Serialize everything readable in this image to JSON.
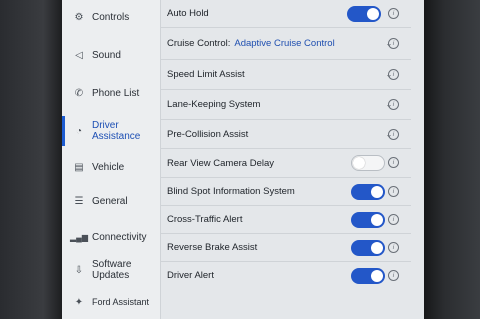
{
  "sidebar": {
    "items": [
      {
        "label": "Controls",
        "icon": "car-controls-icon"
      },
      {
        "label": "Sound",
        "icon": "speaker-icon"
      },
      {
        "label": "Phone List",
        "icon": "phone-icon"
      },
      {
        "label": "Driver Assistance",
        "icon": "driver-assist-icon"
      },
      {
        "label": "Vehicle",
        "icon": "vehicle-icon"
      },
      {
        "label": "General",
        "icon": "settings-sliders-icon"
      },
      {
        "label": "Connectivity",
        "icon": "signal-icon"
      },
      {
        "label": "Software Updates",
        "icon": "download-icon"
      },
      {
        "label": "Ford Assistant",
        "icon": "assistant-icon"
      }
    ],
    "active": "Driver Assistance"
  },
  "settings": {
    "auto_hold": {
      "label": "Auto Hold",
      "on": true
    },
    "cruise_control": {
      "label": "Cruise Control:",
      "value": "Adaptive Cruise Control"
    },
    "speed_limit_assist": {
      "label": "Speed Limit Assist"
    },
    "lane_keeping": {
      "label": "Lane-Keeping System"
    },
    "pre_collision": {
      "label": "Pre-Collision Assist"
    },
    "rear_camera_delay": {
      "label": "Rear View Camera Delay",
      "on": false
    },
    "blind_spot": {
      "label": "Blind Spot Information System",
      "on": true
    },
    "cross_traffic": {
      "label": "Cross-Traffic Alert",
      "on": true
    },
    "reverse_brake": {
      "label": "Reverse Brake Assist",
      "on": true
    },
    "driver_alert": {
      "label": "Driver Alert",
      "on": true
    }
  },
  "info_glyph": "i",
  "colors": {
    "accent": "#2357c8",
    "screen_bg": "#e4e7ea"
  }
}
